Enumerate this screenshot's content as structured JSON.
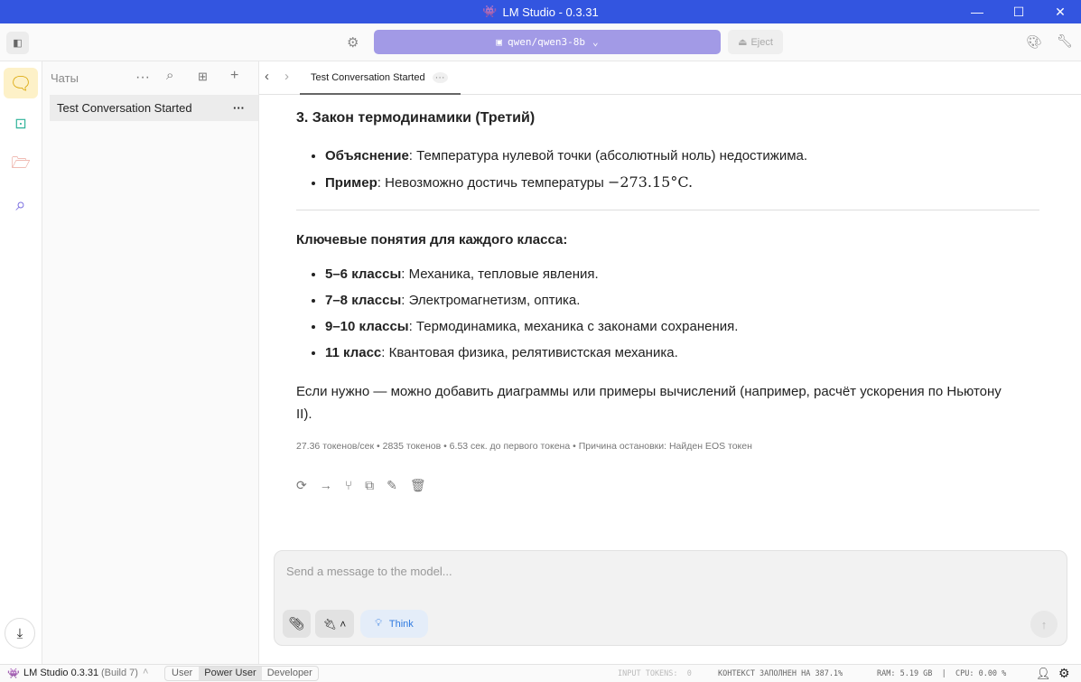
{
  "window": {
    "title": "LM Studio - 0.3.31",
    "minimize": "—",
    "maximize": "☐",
    "close": "✕"
  },
  "toolbar": {
    "model": "qwen/qwen3-8b",
    "eject": "Eject"
  },
  "sidebar": {
    "title": "Чаты",
    "chats": [
      {
        "label": "Test Conversation Started"
      }
    ]
  },
  "tabs": [
    {
      "label": "Test Conversation Started"
    }
  ],
  "message": {
    "heading": "3. Закон термодинамики (Третий)",
    "law_bullets": [
      {
        "bold": "Объяснение",
        "text": ": Температура нулевой точки (абсолютный ноль) недостижима."
      },
      {
        "bold": "Пример",
        "text": ": Невозможно достичь температуры ",
        "math": "−273.15°C."
      }
    ],
    "concepts_title": "Ключевые понятия для каждого класса:",
    "concepts": [
      {
        "bold": "5–6 классы",
        "text": ": Механика, тепловые явления."
      },
      {
        "bold": "7–8 классы",
        "text": ": Электромагнетизм, оптика."
      },
      {
        "bold": "9–10 классы",
        "text": ": Термодинамика, механика с законами сохранения."
      },
      {
        "bold": "11 класс",
        "text": ": Квантовая физика, релятивистская механика."
      }
    ],
    "closing": "Если нужно — можно добавить диаграммы или примеры вычислений (например, расчёт ускорения по Ньютону II).",
    "stats": "27.36 токенов/сек • 2835 токенов • 6.53 сек. до первого токена • Причина остановки: Найден EOS токен"
  },
  "input": {
    "placeholder": "Send a message to the model...",
    "think": "Think"
  },
  "status": {
    "app": "LM Studio 0.3.31",
    "build": "(Build 7)",
    "modes": [
      "User",
      "Power User",
      "Developer"
    ],
    "active_mode": "Power User",
    "input_tokens": "INPUT TOKENS:  0",
    "context": "КОНТЕКСТ ЗАПОЛНЕН НА 387.1%",
    "ram_cpu": "RAM: 5.19 GB  |  CPU: 0.00 %"
  },
  "colors": {
    "titlebar": "#3355e0",
    "model_pill": "#a29ae6",
    "chat_active": "#fdf1c8",
    "think": "#2f7ae0"
  }
}
